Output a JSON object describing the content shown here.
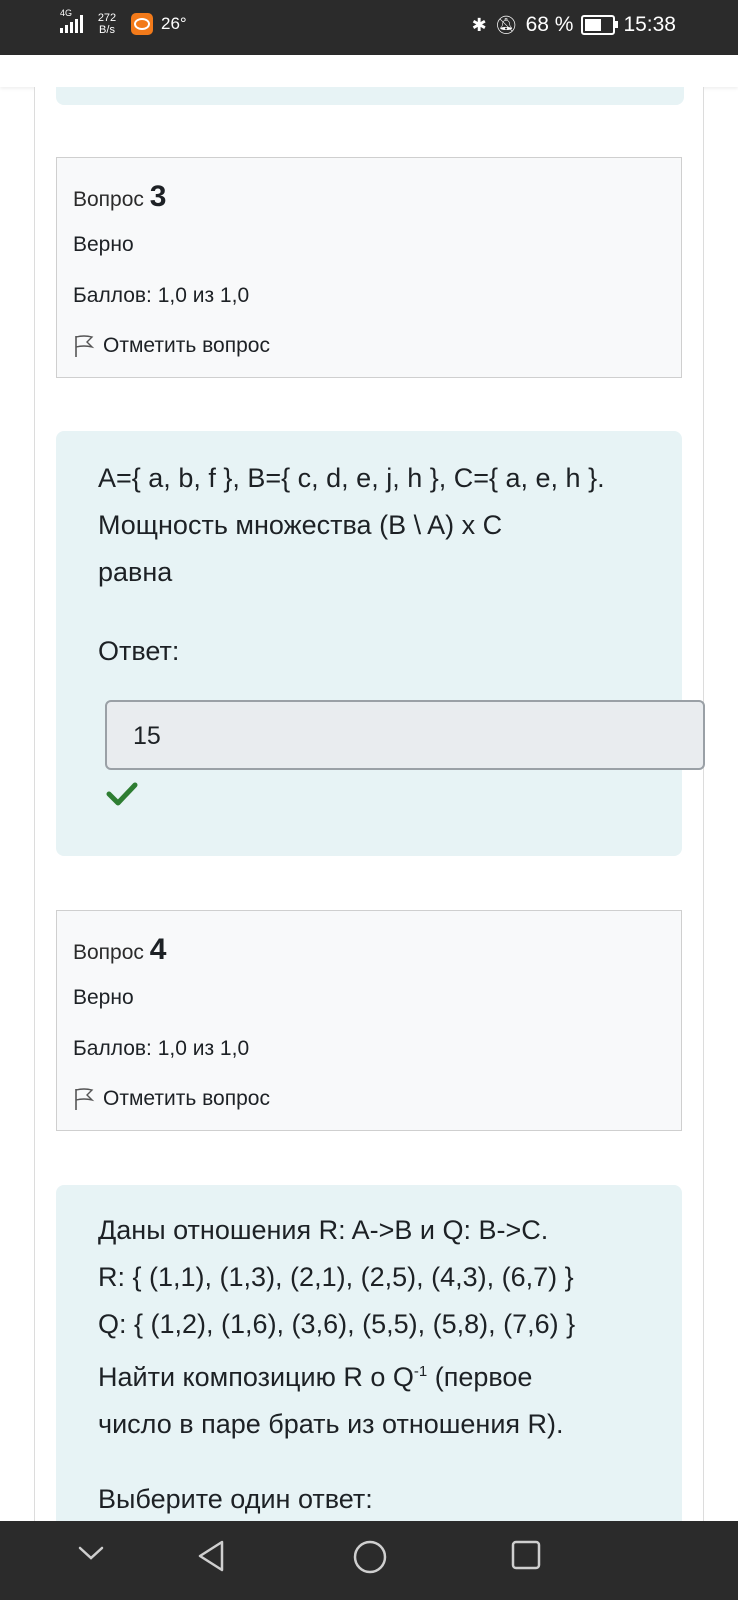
{
  "status_bar": {
    "network_type": "4G",
    "net_speed_value": "272",
    "net_speed_unit": "B/s",
    "temperature": "26°",
    "battery": "68 %",
    "battery_level": 0.68,
    "time": "15:38"
  },
  "question3": {
    "title_prefix": "Вопрос",
    "number": "3",
    "state": "Верно",
    "grade": "Баллов: 1,0 из 1,0",
    "flag_label": "Отметить вопрос",
    "text_lines": [
      "A={ a, b, f }, B={ c, d, e, j, h }, C={ a, e, h }.",
      "Мощность множества (B \\ A) x C",
      "равна"
    ],
    "answer_label": "Ответ:",
    "answer_value": "15"
  },
  "question4": {
    "title_prefix": "Вопрос",
    "number": "4",
    "state": "Верно",
    "grade": "Баллов: 1,0 из 1,0",
    "flag_label": "Отметить вопрос",
    "text_lines": [
      "Даны отношения R: A->B  и  Q: B->C.",
      "R: { (1,1), (1,3), (2,1), (2,5), (4,3), (6,7) }",
      "Q: { (1,2), (1,6), (3,6), (5,5), (5,8), (7,6) }"
    ],
    "line4_before": "Найти композицию R o Q",
    "line4_sup": "-1",
    "line4_after": " (первое",
    "line5": "число в паре брать из отношения R).",
    "choose_label": "Выберите один ответ:"
  },
  "icons": {
    "flag": "flag-icon",
    "check": "check-icon",
    "bluetooth": "bluetooth-icon",
    "mute": "bell-off-icon"
  },
  "colors": {
    "status_bar": "#2b2b2b",
    "content_bg": "#e7f3f5",
    "info_bg": "#f8f9fa",
    "correct_green": "#2e7d32"
  }
}
